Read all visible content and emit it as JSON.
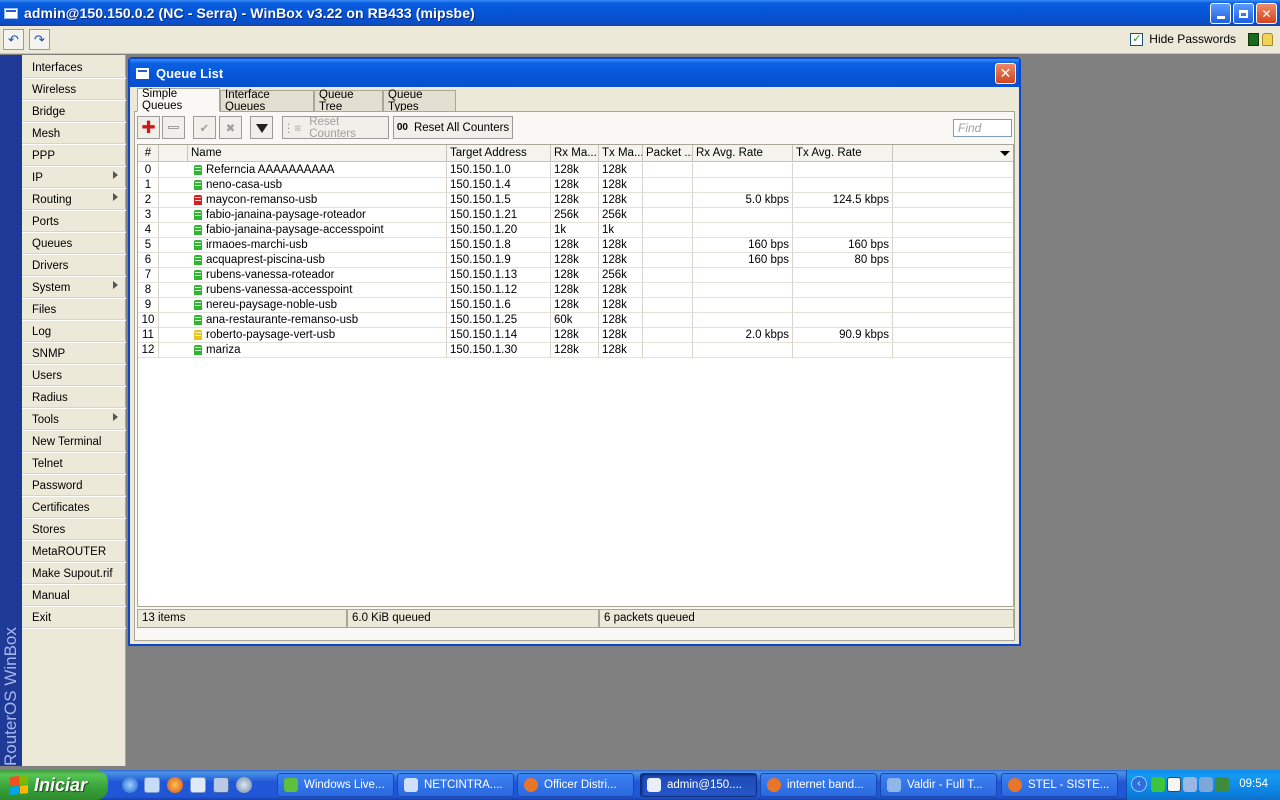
{
  "window": {
    "title": "admin@150.150.0.2 (NC - Serra) - WinBox v3.22 on RB433 (mipsbe)"
  },
  "toolbar": {
    "undo_icon": "undo-icon",
    "redo_icon": "redo-icon",
    "hide_passwords_label": "Hide Passwords",
    "hide_passwords_checked": true
  },
  "sidebar": {
    "brand": "RouterOS WinBox",
    "items": [
      {
        "label": "Interfaces",
        "submenu": false
      },
      {
        "label": "Wireless",
        "submenu": false
      },
      {
        "label": "Bridge",
        "submenu": false
      },
      {
        "label": "Mesh",
        "submenu": false
      },
      {
        "label": "PPP",
        "submenu": false
      },
      {
        "label": "IP",
        "submenu": true
      },
      {
        "label": "Routing",
        "submenu": true
      },
      {
        "label": "Ports",
        "submenu": false
      },
      {
        "label": "Queues",
        "submenu": false
      },
      {
        "label": "Drivers",
        "submenu": false
      },
      {
        "label": "System",
        "submenu": true
      },
      {
        "label": "Files",
        "submenu": false
      },
      {
        "label": "Log",
        "submenu": false
      },
      {
        "label": "SNMP",
        "submenu": false
      },
      {
        "label": "Users",
        "submenu": false
      },
      {
        "label": "Radius",
        "submenu": false
      },
      {
        "label": "Tools",
        "submenu": true
      },
      {
        "label": "New Terminal",
        "submenu": false
      },
      {
        "label": "Telnet",
        "submenu": false
      },
      {
        "label": "Password",
        "submenu": false
      },
      {
        "label": "Certificates",
        "submenu": false
      },
      {
        "label": "Stores",
        "submenu": false
      },
      {
        "label": "MetaROUTER",
        "submenu": false
      },
      {
        "label": "Make Supout.rif",
        "submenu": false
      },
      {
        "label": "Manual",
        "submenu": false
      },
      {
        "label": "Exit",
        "submenu": false
      }
    ]
  },
  "queue_window": {
    "title": "Queue List",
    "tabs": [
      {
        "label": "Simple Queues",
        "active": true
      },
      {
        "label": "Interface Queues",
        "active": false
      },
      {
        "label": "Queue Tree",
        "active": false
      },
      {
        "label": "Queue Types",
        "active": false
      }
    ],
    "buttons": {
      "reset_counters": "Reset Counters",
      "reset_all_counters": "Reset All Counters",
      "reset_all_prefix": "00"
    },
    "find_placeholder": "Find",
    "columns": [
      "#",
      "",
      "Name",
      "Target Address",
      "Rx Ma...",
      "Tx Ma...",
      "Packet ...",
      "Rx Avg. Rate",
      "Tx Avg. Rate"
    ],
    "rows": [
      {
        "id": "0",
        "status": "green",
        "name": "Referncia AAAAAAAAAA",
        "target": "150.150.1.0",
        "rx_max": "128k",
        "tx_max": "128k",
        "packet": "",
        "rx_avg": "",
        "tx_avg": ""
      },
      {
        "id": "1",
        "status": "green",
        "name": "neno-casa-usb",
        "target": "150.150.1.4",
        "rx_max": "128k",
        "tx_max": "128k",
        "packet": "",
        "rx_avg": "",
        "tx_avg": ""
      },
      {
        "id": "2",
        "status": "red",
        "name": "maycon-remanso-usb",
        "target": "150.150.1.5",
        "rx_max": "128k",
        "tx_max": "128k",
        "packet": "",
        "rx_avg": "5.0 kbps",
        "tx_avg": "124.5 kbps"
      },
      {
        "id": "3",
        "status": "green",
        "name": "fabio-janaina-paysage-roteador",
        "target": "150.150.1.21",
        "rx_max": "256k",
        "tx_max": "256k",
        "packet": "",
        "rx_avg": "",
        "tx_avg": ""
      },
      {
        "id": "4",
        "status": "green",
        "name": "fabio-janaina-paysage-accesspoint",
        "target": "150.150.1.20",
        "rx_max": "1k",
        "tx_max": "1k",
        "packet": "",
        "rx_avg": "",
        "tx_avg": ""
      },
      {
        "id": "5",
        "status": "green",
        "name": "irmaoes-marchi-usb",
        "target": "150.150.1.8",
        "rx_max": "128k",
        "tx_max": "128k",
        "packet": "",
        "rx_avg": "160 bps",
        "tx_avg": "160 bps"
      },
      {
        "id": "6",
        "status": "green",
        "name": "acquaprest-piscina-usb",
        "target": "150.150.1.9",
        "rx_max": "128k",
        "tx_max": "128k",
        "packet": "",
        "rx_avg": "160 bps",
        "tx_avg": "80 bps"
      },
      {
        "id": "7",
        "status": "green",
        "name": "rubens-vanessa-roteador",
        "target": "150.150.1.13",
        "rx_max": "128k",
        "tx_max": "256k",
        "packet": "",
        "rx_avg": "",
        "tx_avg": ""
      },
      {
        "id": "8",
        "status": "green",
        "name": "rubens-vanessa-accesspoint",
        "target": "150.150.1.12",
        "rx_max": "128k",
        "tx_max": "128k",
        "packet": "",
        "rx_avg": "",
        "tx_avg": ""
      },
      {
        "id": "9",
        "status": "green",
        "name": "nereu-paysage-noble-usb",
        "target": "150.150.1.6",
        "rx_max": "128k",
        "tx_max": "128k",
        "packet": "",
        "rx_avg": "",
        "tx_avg": ""
      },
      {
        "id": "10",
        "status": "green",
        "name": "ana-restaurante-remanso-usb",
        "target": "150.150.1.25",
        "rx_max": "60k",
        "tx_max": "128k",
        "packet": "",
        "rx_avg": "",
        "tx_avg": ""
      },
      {
        "id": "11",
        "status": "yellow",
        "name": "roberto-paysage-vert-usb",
        "target": "150.150.1.14",
        "rx_max": "128k",
        "tx_max": "128k",
        "packet": "",
        "rx_avg": "2.0 kbps",
        "tx_avg": "90.9 kbps"
      },
      {
        "id": "12",
        "status": "green",
        "name": "mariza",
        "target": "150.150.1.30",
        "rx_max": "128k",
        "tx_max": "128k",
        "packet": "",
        "rx_avg": "",
        "tx_avg": ""
      }
    ],
    "status": {
      "items": "13 items",
      "queued": "6.0 KiB queued",
      "packets": "6 packets queued"
    }
  },
  "status_colors": {
    "green": "#2fb52f",
    "red": "#d81f1f",
    "yellow": "#e8c51a"
  },
  "taskbar": {
    "start_label": "Iniciar",
    "tasks": [
      {
        "label": "Windows Live...",
        "icon": "messenger-icon",
        "active": false
      },
      {
        "label": "NETCINTRA....",
        "icon": "network-icon",
        "active": false
      },
      {
        "label": "Officer Distri...",
        "icon": "firefox-icon",
        "active": false
      },
      {
        "label": "admin@150....",
        "icon": "winbox-icon",
        "active": true
      },
      {
        "label": "internet band...",
        "icon": "firefox-icon",
        "active": false
      },
      {
        "label": "Valdir - Full T...",
        "icon": "chat-icon",
        "active": false
      },
      {
        "label": "STEL - SISTE...",
        "icon": "firefox-icon",
        "active": false
      }
    ],
    "clock": "09:54"
  }
}
